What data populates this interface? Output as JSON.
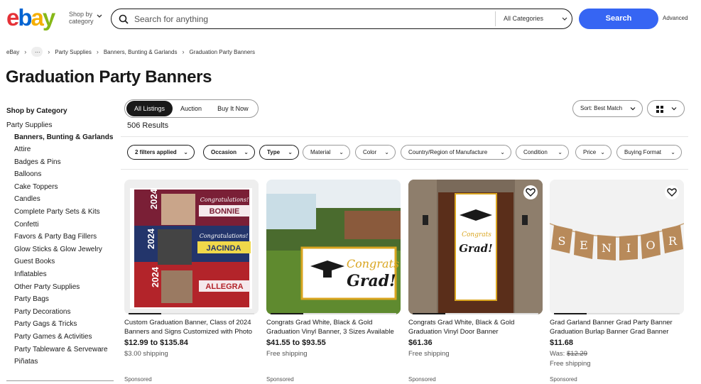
{
  "header": {
    "logo_letters": [
      "e",
      "b",
      "a",
      "y"
    ],
    "logo_colors": [
      "#e53238",
      "#0064d2",
      "#f5af02",
      "#86b817"
    ],
    "shop_by_line1": "Shop by",
    "shop_by_line2": "category",
    "search_placeholder": "Search for anything",
    "category_select": "All Categories",
    "search_button": "Search",
    "advanced_link": "Advanced"
  },
  "breadcrumb": {
    "items": [
      "eBay",
      "…",
      "Party Supplies",
      "Banners, Bunting & Garlands",
      "Graduation Party Banners"
    ]
  },
  "page_title": "Graduation Party Banners",
  "sidebar": {
    "heading": "Shop by Category",
    "parent": "Party Supplies",
    "active": "Banners, Bunting & Garlands",
    "items": [
      "Attire",
      "Badges & Pins",
      "Balloons",
      "Cake Toppers",
      "Candles",
      "Complete Party Sets & Kits",
      "Confetti",
      "Favors & Party Bag Fillers",
      "Glow Sticks & Glow Jewelry",
      "Guest Books",
      "Inflatables",
      "Other Party Supplies",
      "Party Bags",
      "Party Decorations",
      "Party Gags & Tricks",
      "Party Games & Activities",
      "Party Tableware & Serveware",
      "Piñatas"
    ]
  },
  "tabs": [
    "All Listings",
    "Auction",
    "Buy It Now"
  ],
  "results": "506 Results",
  "sort_label": "Sort: Best Match",
  "filters": [
    "2 filters applied",
    "Occasion",
    "Type",
    "Material",
    "Color",
    "Country/Region of Manufacture",
    "Condition",
    "Price",
    "Buying Format"
  ],
  "listings": [
    {
      "title": "Custom Graduation Banner, Class of 2024 Banners and Signs Customized with Photo",
      "price": "$12.99 to $135.84",
      "shipping": "$3.00 shipping",
      "sponsored": "Sponsored",
      "banner_names": [
        "BONNIE",
        "JACINDA",
        "ALLEGRA"
      ],
      "banner_script": "Congratulations!",
      "banner_year": "2024"
    },
    {
      "title": "Congrats Grad White, Black & Gold Graduation Vinyl Banner, 3 Sizes Available",
      "price": "$41.55 to $93.55",
      "shipping": "Free shipping",
      "sponsored": "Sponsored",
      "banner_text1": "Congrats",
      "banner_text2": "Grad!"
    },
    {
      "title": "Congrats Grad White, Black & Gold Graduation Vinyl Door Banner",
      "price": "$61.36",
      "shipping": "Free shipping",
      "sponsored": "Sponsored",
      "banner_text1": "Congrats",
      "banner_text2": "Grad!"
    },
    {
      "title": "Grad Garland Banner Grad Party Banner Graduation Burlap Banner Grad Banner",
      "price": "$11.68",
      "was_label": "Was:",
      "was_price": "$12.29",
      "shipping": "Free shipping",
      "sponsored": "Sponsored",
      "garland_letters": [
        "S",
        "E",
        "N",
        "I",
        "O",
        "R"
      ]
    }
  ]
}
